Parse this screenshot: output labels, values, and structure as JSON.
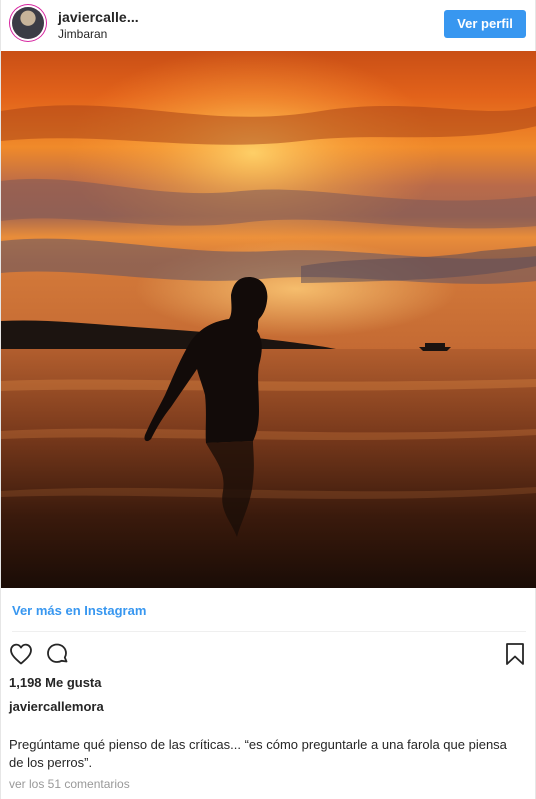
{
  "header": {
    "username": "javiercalle...",
    "location": "Jimbaran",
    "view_profile_label": "Ver perfil"
  },
  "post": {
    "view_more_label": "Ver más en Instagram",
    "likes": "1,198 Me gusta",
    "caption_user": "javiercallemora",
    "caption_text": "Pregúntame qué pienso de las críticas... “es cómo preguntarle a una farola que piensa de los perros”.",
    "comments_link": "ver los 51 comentarios"
  },
  "icons": {
    "like": "heart-icon",
    "comment": "comment-bubble-icon",
    "save": "bookmark-icon"
  },
  "colors": {
    "accent": "#3897f0",
    "text": "#262626",
    "muted": "#999999"
  }
}
